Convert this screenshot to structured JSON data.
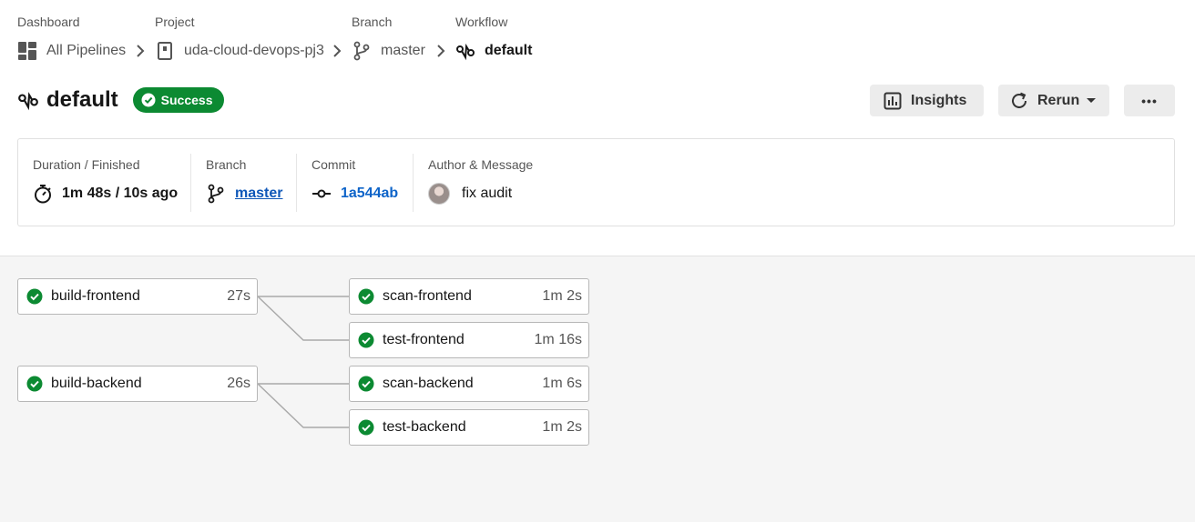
{
  "breadcrumb": {
    "labels": [
      "Dashboard",
      "Project",
      "Branch",
      "Workflow"
    ],
    "items": [
      {
        "text": "All Pipelines",
        "icon": "dashboard-grid-icon"
      },
      {
        "text": "uda-cloud-devops-pj3",
        "icon": "repository-icon"
      },
      {
        "text": "master",
        "icon": "branch-icon"
      },
      {
        "text": "default",
        "icon": "workflow-icon"
      }
    ]
  },
  "header": {
    "title": "default",
    "status": "Success",
    "status_color": "#0c8a32",
    "insights_label": "Insights",
    "rerun_label": "Rerun",
    "more_label": "•••"
  },
  "info": {
    "duration_label": "Duration / Finished",
    "duration_value": "1m 48s / 10s ago",
    "branch_label": "Branch",
    "branch_value": "master",
    "commit_label": "Commit",
    "commit_value": "1a544ab",
    "author_label": "Author & Message",
    "message": "fix audit"
  },
  "jobs": [
    {
      "name": "build-frontend",
      "time": "27s"
    },
    {
      "name": "scan-frontend",
      "time": "1m 2s"
    },
    {
      "name": "test-frontend",
      "time": "1m 16s"
    },
    {
      "name": "build-backend",
      "time": "26s"
    },
    {
      "name": "scan-backend",
      "time": "1m 6s"
    },
    {
      "name": "test-backend",
      "time": "1m 2s"
    }
  ],
  "colors": {
    "success": "#0c8a32",
    "link": "#0e57b8"
  }
}
